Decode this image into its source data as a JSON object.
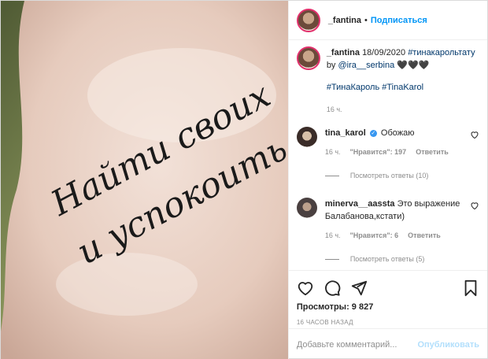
{
  "header": {
    "username": "_fantina",
    "separator": "•",
    "follow_label": "Подписаться"
  },
  "photo": {
    "tattoo_line1": "Найти своих",
    "tattoo_line2": "и успокоить"
  },
  "caption": {
    "username": "_fantina",
    "date": "18/09/2020",
    "hashtag1": "#тинакарольтату",
    "by": "by",
    "mention": "@ira__serbina",
    "hearts": "🖤🖤🖤",
    "hashtags2": "#ТинаКароль #TinaKarol",
    "time": "16 ч."
  },
  "comments": [
    {
      "username": "tina_karol",
      "verified_mark": "✓",
      "text": "Обожаю",
      "time": "16 ч.",
      "likes": "\"Нравится\": 197",
      "reply": "Ответить",
      "view_replies": "Посмотреть ответы (10)"
    },
    {
      "username": "minerva__aassta",
      "text": "Это выражение Балабанова,кстати)",
      "time": "16 ч.",
      "likes": "\"Нравится\": 6",
      "reply": "Ответить",
      "view_replies": "Посмотреть ответы (5)"
    }
  ],
  "stats": {
    "views": "Просмотры: 9 827",
    "ago": "16 ЧАСОВ НАЗАД"
  },
  "add_comment": {
    "placeholder": "Добавьте комментарий...",
    "publish_label": "Опубликовать"
  },
  "colors": {
    "accent": "#0095f6",
    "publish_disabled": "#b2dffc",
    "link": "#00376b",
    "muted": "#8e8e8e"
  },
  "icons": [
    "heart-icon",
    "comment-icon",
    "share-icon",
    "bookmark-icon",
    "verified-icon"
  ]
}
